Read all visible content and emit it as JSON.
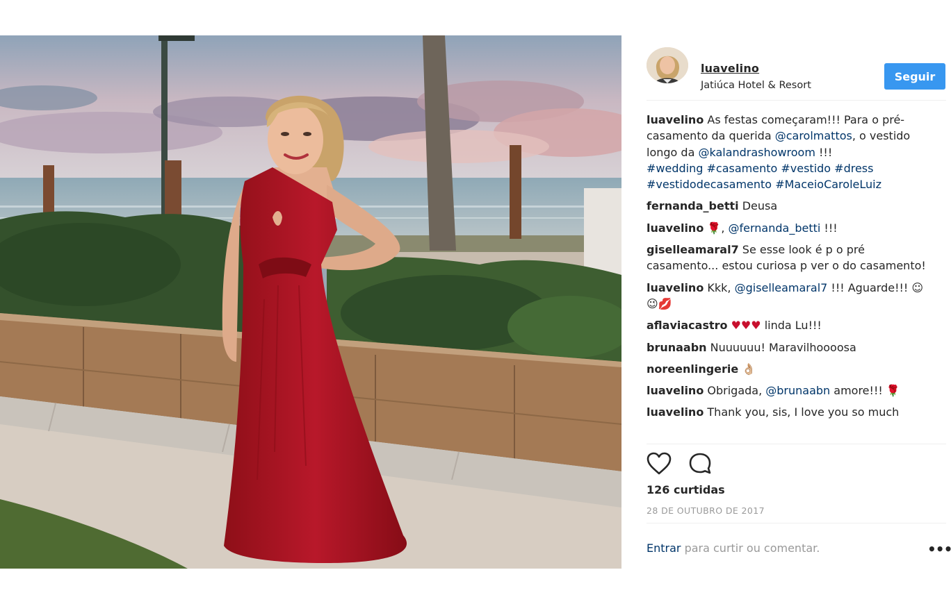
{
  "post": {
    "author": "luavelino",
    "location": "Jatiúca Hotel & Resort",
    "follow_label": "Seguir",
    "caption": {
      "user": "luavelino",
      "text1": " As festas começaram!!! Para o pré-casamento da querida ",
      "mention1": "@carolmattos",
      "text2": ", o vestido longo da ",
      "mention2": "@kalandrashowroom",
      "text3": " !!! ",
      "hashtags": [
        "#wedding",
        "#casamento",
        "#vestido",
        "#dress",
        "#vestidodecasamento",
        "#MaceioCaroleLuiz"
      ]
    },
    "comments": [
      {
        "user": "fernanda_betti",
        "text": " Deusa"
      },
      {
        "user": "luavelino",
        "text_pre": " 🌹, ",
        "mention": "@fernanda_betti",
        "text_post": " !!!"
      },
      {
        "user": "giselleamaral7",
        "text": " Se esse look é p o pré casamento... estou curiosa p ver o do casamento!"
      },
      {
        "user": "luavelino",
        "text_pre": " Kkk, ",
        "mention": "@giselleamaral7",
        "text_post": " !!! Aguarde!!! ☺😉💋"
      },
      {
        "user": "aflaviacastro",
        "hearts": " ♥♥♥",
        "text": " linda Lu!!!"
      },
      {
        "user": "brunaabn",
        "text": " Nuuuuuu! Maravilhoooosa"
      },
      {
        "user": "noreenlingerie",
        "text": " 👌🏼"
      },
      {
        "user": "luavelino",
        "text_pre": " Obrigada, ",
        "mention": "@brunaabn",
        "text_post": " amore!!! 🌹"
      },
      {
        "user": "luavelino",
        "text": " Thank you, sis, I love you so much"
      }
    ],
    "likes": "126 curtidas",
    "date": "28 DE OUTUBRO DE 2017",
    "login_link": "Entrar",
    "login_rest": " para curtir ou comentar.",
    "more_label": "•••",
    "icons": {
      "like": "heart-icon",
      "comment": "comment-icon"
    },
    "colors": {
      "follow_bg": "#3897f0",
      "mention": "#003569",
      "dress": "#a3141f"
    }
  }
}
